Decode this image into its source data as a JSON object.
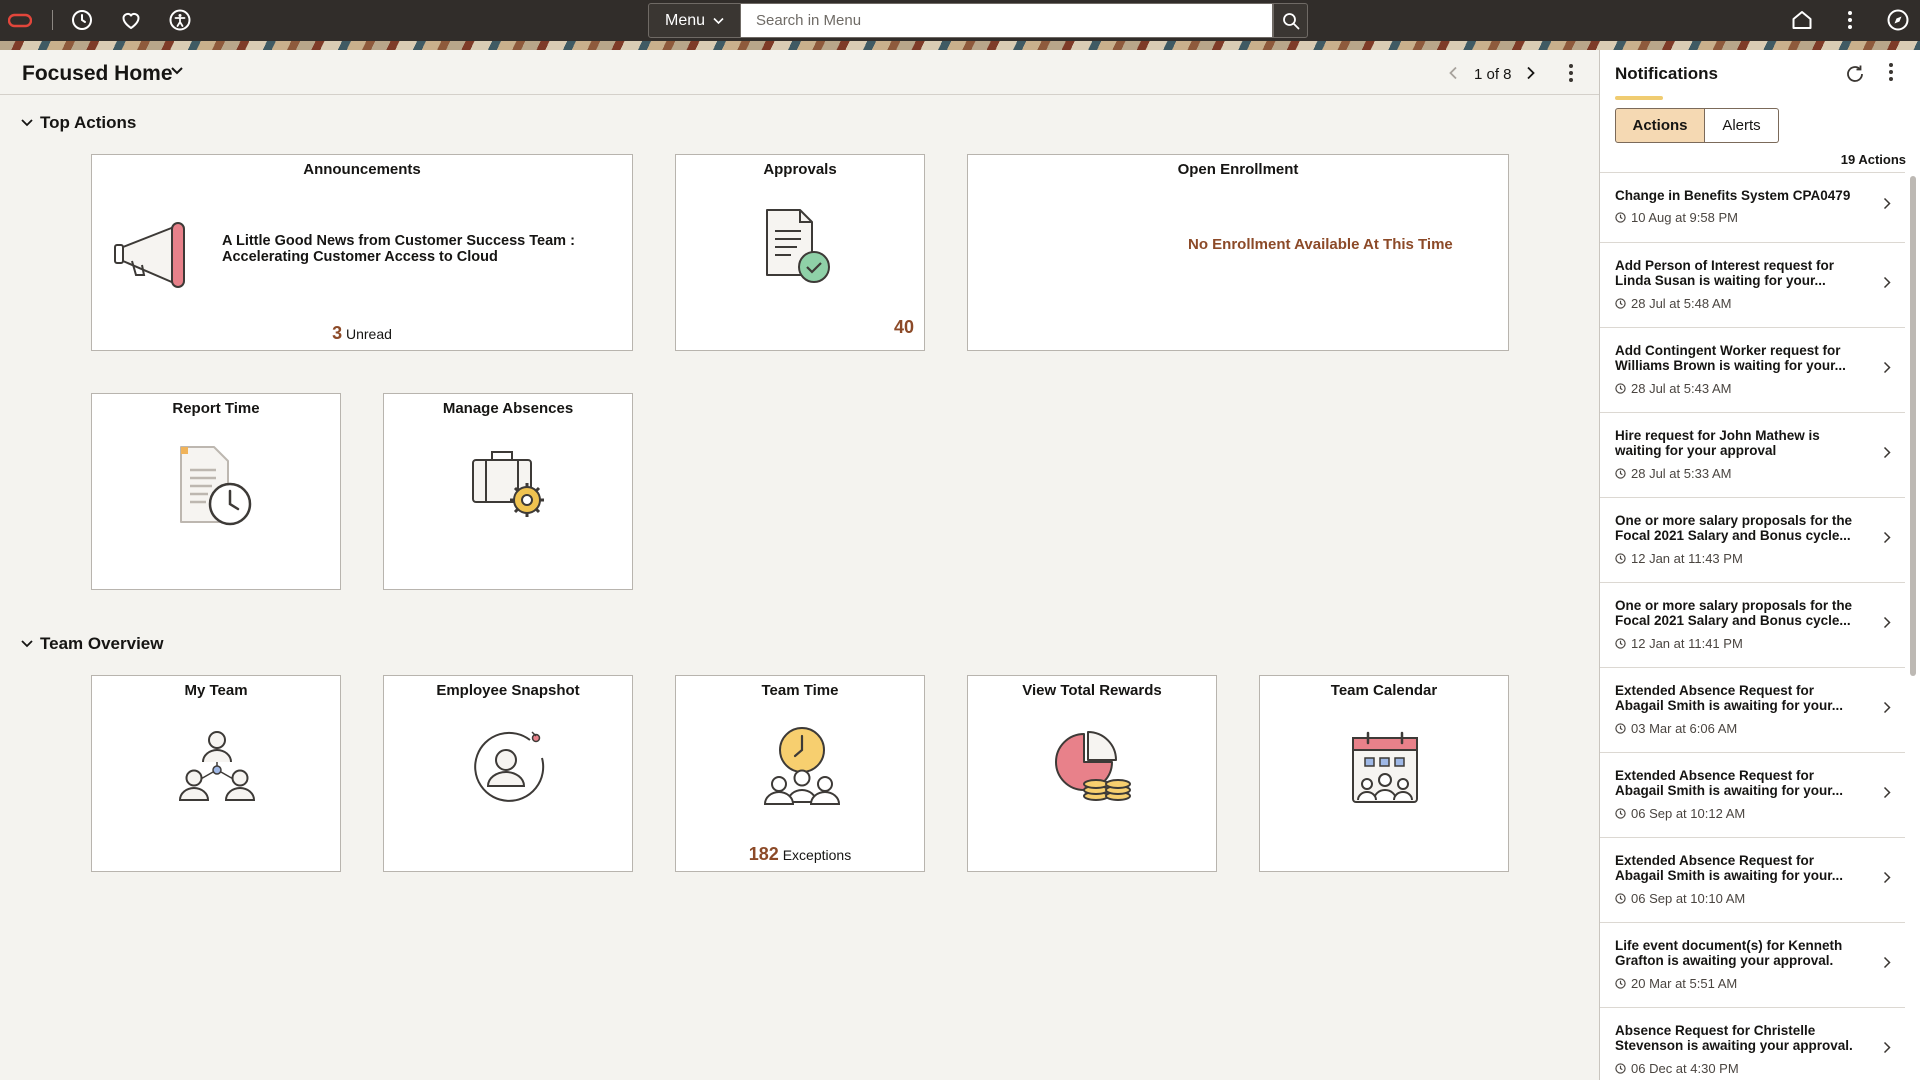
{
  "topbar": {
    "menu_label": "Menu",
    "search_placeholder": "Search in Menu"
  },
  "header": {
    "title": "Focused Home",
    "pager": "1 of 8"
  },
  "sections": {
    "top_actions": "Top Actions",
    "team_overview": "Team Overview"
  },
  "tiles": {
    "announcements": {
      "title": "Announcements",
      "headline": "A Little Good News from Customer Success Team : Accelerating Customer Access to Cloud",
      "count": "3",
      "count_label": "Unread"
    },
    "approvals": {
      "title": "Approvals",
      "count": "40"
    },
    "open_enrollment": {
      "title": "Open Enrollment",
      "message": "No Enrollment Available At This Time"
    },
    "report_time": {
      "title": "Report Time"
    },
    "manage_absences": {
      "title": "Manage Absences"
    },
    "my_team": {
      "title": "My Team"
    },
    "employee_snapshot": {
      "title": "Employee Snapshot"
    },
    "team_time": {
      "title": "Team Time",
      "count": "182",
      "count_label": "Exceptions"
    },
    "view_total_rewards": {
      "title": "View Total Rewards"
    },
    "team_calendar": {
      "title": "Team Calendar"
    }
  },
  "notifications": {
    "title": "Notifications",
    "tab_actions": "Actions",
    "tab_alerts": "Alerts",
    "count": "19 Actions",
    "items": [
      {
        "msg": "Change in Benefits System CPA0479",
        "time": "10 Aug at 9:58 PM"
      },
      {
        "msg": "Add Person of Interest request for Linda Susan is waiting for your...",
        "time": "28 Jul at 5:48 AM"
      },
      {
        "msg": "Add Contingent Worker request for Williams Brown is waiting for your...",
        "time": "28 Jul at 5:43 AM"
      },
      {
        "msg": "Hire request for John Mathew is waiting for your approval",
        "time": "28 Jul at 5:33 AM"
      },
      {
        "msg": "One or more salary proposals for the Focal 2021 Salary and Bonus cycle...",
        "time": "12 Jan at 11:43 PM"
      },
      {
        "msg": "One or more salary proposals for the Focal 2021 Salary and Bonus cycle...",
        "time": "12 Jan at 11:41 PM"
      },
      {
        "msg": "Extended Absence Request for Abagail Smith is awaiting for your...",
        "time": "03 Mar at 6:06 AM"
      },
      {
        "msg": "Extended Absence Request for Abagail Smith is awaiting for your...",
        "time": "06 Sep at 10:12 AM"
      },
      {
        "msg": "Extended Absence Request for Abagail Smith is awaiting for your...",
        "time": "06 Sep at 10:10 AM"
      },
      {
        "msg": "Life event document(s) for Kenneth Grafton is awaiting your approval.",
        "time": "20 Mar at 5:51 AM"
      },
      {
        "msg": "Absence Request for Christelle Stevenson is awaiting your approval.",
        "time": "06 Dec at 4:30 PM"
      }
    ]
  }
}
